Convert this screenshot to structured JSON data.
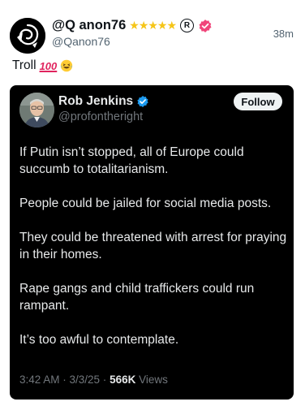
{
  "post": {
    "display_name": "@Q anon76",
    "stars": "★★★★★",
    "reg_mark": "R",
    "handle": "@Qanon76",
    "time": "38m",
    "text": "Troll",
    "emoji_100": "100",
    "icons": {
      "avatar": "spiral-logo-icon",
      "verified": "pink-verified-badge-icon",
      "laugh": "laughing-emoji-icon"
    }
  },
  "quoted": {
    "display_name": "Rob Jenkins",
    "handle": "@profontheright",
    "follow_label": "Follow",
    "paragraphs": [
      "If Putin isn’t stopped, all of Europe could succumb to totalitarianism.",
      "People could be jailed for social media posts.",
      "They could be threatened with arrest for praying in their homes.",
      "Rape gangs and child traffickers could run rampant.",
      "It’s too awful to contemplate."
    ],
    "timestamp": "3:42 AM · 3/3/25 · ",
    "views_count": "566K",
    "views_label": " Views",
    "icons": {
      "verified": "blue-verified-badge-icon",
      "avatar": "profile-photo-icon"
    }
  },
  "colors": {
    "accent_blue": "#1d9bf0",
    "pink_badge": "#f0457a",
    "star_gold": "#f5c518"
  }
}
